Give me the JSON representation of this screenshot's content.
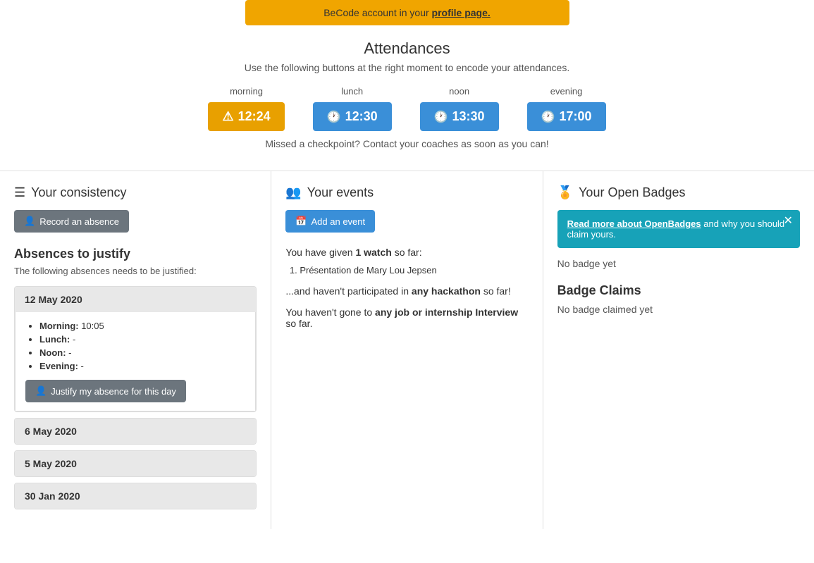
{
  "banner": {
    "text": "BeCode account in your ",
    "link_text": "profile page."
  },
  "attendances": {
    "title": "Attendances",
    "description": "Use the following buttons at the right moment to encode your attendances.",
    "missed_text": "Missed a checkpoint? Contact your coaches as soon as you can!",
    "checkpoints": [
      {
        "id": "morning",
        "label": "morning",
        "time": "12:24",
        "style": "warning"
      },
      {
        "id": "lunch",
        "label": "lunch",
        "time": "12:30",
        "style": "blue"
      },
      {
        "id": "noon",
        "label": "noon",
        "time": "13:30",
        "style": "blue"
      },
      {
        "id": "evening",
        "label": "evening",
        "time": "17:00",
        "style": "blue"
      }
    ]
  },
  "consistency": {
    "title": "Your consistency",
    "record_btn": "Record an absence",
    "absences_heading": "Absences to justify",
    "absences_sub": "The following absences needs to be justified:",
    "dates": [
      {
        "date": "12 May 2020",
        "expanded": true,
        "entries": [
          {
            "label": "Morning:",
            "value": "10:05"
          },
          {
            "label": "Lunch:",
            "value": "-"
          },
          {
            "label": "Noon:",
            "value": "-"
          },
          {
            "label": "Evening:",
            "value": "-"
          }
        ],
        "justify_btn": "Justify my absence for this day"
      },
      {
        "date": "6 May 2020",
        "expanded": false
      },
      {
        "date": "5 May 2020",
        "expanded": false
      },
      {
        "date": "30 Jan 2020",
        "expanded": false
      }
    ]
  },
  "events": {
    "title": "Your events",
    "add_btn": "Add an event",
    "watch_text_prefix": "You have given ",
    "watch_count": "1 watch",
    "watch_text_suffix": " so far:",
    "presentations": [
      "Présentation de Mary Lou Jepsen"
    ],
    "no_hackathon_prefix": "...and haven't participated in ",
    "hackathon_text": "any hackathon",
    "no_hackathon_suffix": " so far!",
    "no_job_prefix": "You haven't gone to ",
    "job_text": "any job or internship Interview",
    "no_job_suffix": " so far."
  },
  "open_badges": {
    "title": "Your Open Badges",
    "alert_link": "Read more about OpenBadges",
    "alert_text": " and why you should claim yours.",
    "no_badge_text": "No badge yet",
    "badge_claims_heading": "Badge Claims",
    "no_claimed_text": "No badge claimed yet"
  }
}
